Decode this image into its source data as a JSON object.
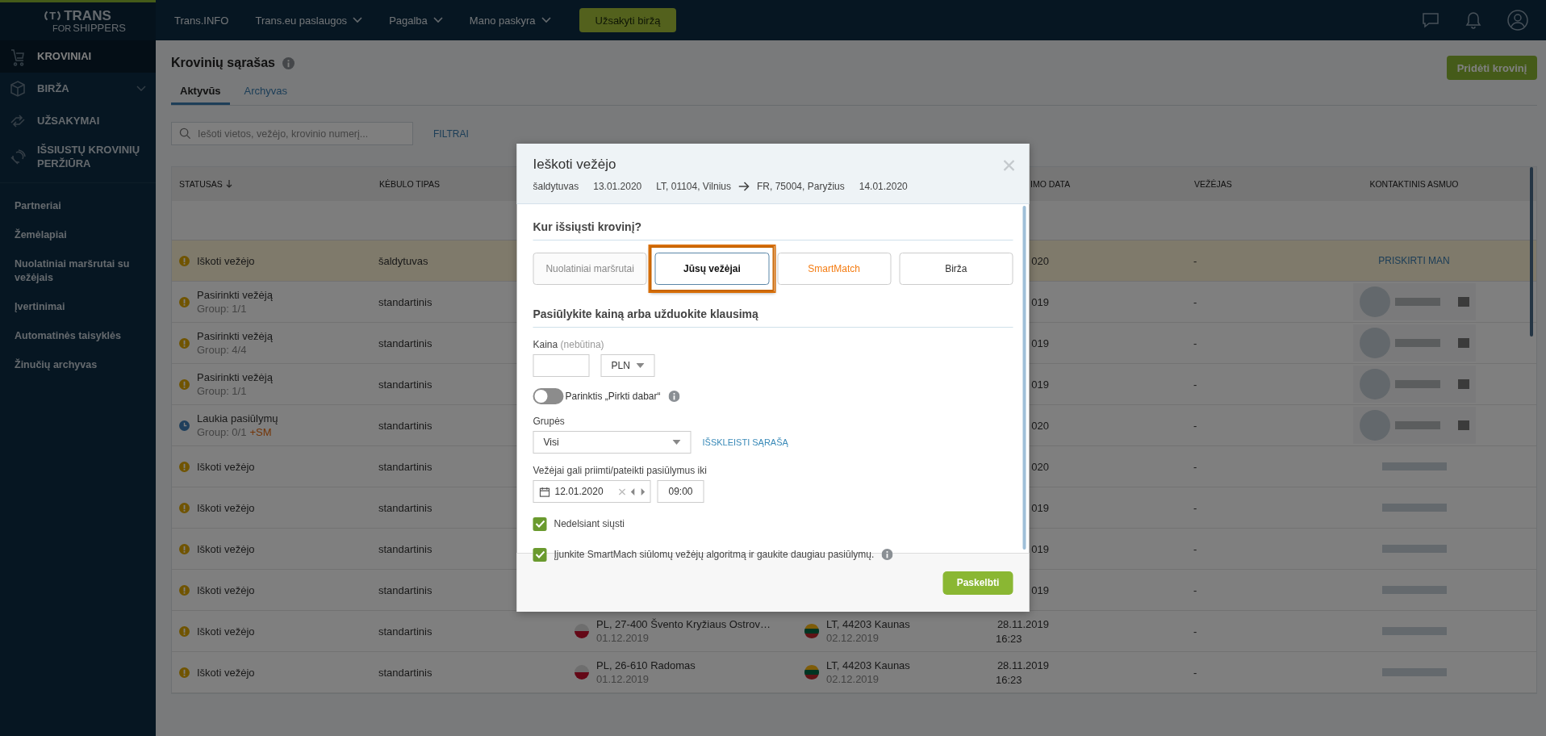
{
  "logo": {
    "mark": "T",
    "name": "TRANS",
    "tagline_small": "FOR",
    "tagline": "SHIPPERS"
  },
  "topnav": {
    "items": [
      {
        "label": "Trans.INFO",
        "dropdown": false
      },
      {
        "label": "Trans.eu paslaugos",
        "dropdown": true
      },
      {
        "label": "Pagalba",
        "dropdown": true
      },
      {
        "label": "Mano paskyra",
        "dropdown": true
      }
    ],
    "cta": "Užsakyti biržą"
  },
  "sidebar": {
    "main": [
      {
        "label": "KROVINIAI",
        "selected": true,
        "expandable": false
      },
      {
        "label": "BIRŽA",
        "selected": false,
        "expandable": true
      },
      {
        "label": "UŽSAKYMAI",
        "selected": false,
        "expandable": false
      },
      {
        "label": "IŠSIUSTŲ KROVINIŲ PERŽIŪRA",
        "selected": false,
        "expandable": false
      }
    ],
    "links": [
      "Partneriai",
      "Žemėlapiai",
      "Nuolatiniai maršrutai su vežėjais",
      "Įvertinimai",
      "Automatinės taisyklės",
      "Žinučių archyvas"
    ]
  },
  "page": {
    "title": "Krovinių sąrašas",
    "add_button": "Pridėti krovinį",
    "tabs": [
      {
        "label": "Aktyvūs",
        "selected": true
      },
      {
        "label": "Archyvas",
        "selected": false
      }
    ],
    "search": {
      "placeholder": "Iešoti vietos, vežėjo, krovinio numerį..."
    },
    "filters": "FILTRAI"
  },
  "table": {
    "columns": {
      "status": "STATUSAS",
      "body": "KĖBULO TIPAS",
      "date": "IMO DATA",
      "carrier": "VEŽĖJAS",
      "contact": "KONTAKTINIS ASMUO"
    },
    "rows": [
      {
        "kind": "warning",
        "status": "Iškoti vežėjo",
        "body": "šaldytuvas",
        "date": "020",
        "carrier": "-",
        "contact": {
          "kind": "assign",
          "text": "PRISKIRTI MAN"
        },
        "highlighted": true
      },
      {
        "kind": "warning",
        "status": "Pasirinkti vežėją",
        "group": "Group: 1/1",
        "body": "standartinis",
        "date": "019",
        "carrier": "-",
        "contact": {
          "kind": "avatar"
        },
        "highlighted": false
      },
      {
        "kind": "warning",
        "status": "Pasirinkti vežėją",
        "group": "Group: 4/4",
        "body": "standartinis",
        "date": "019",
        "carrier": "-",
        "contact": {
          "kind": "avatar"
        },
        "highlighted": false
      },
      {
        "kind": "warning",
        "status": "Pasirinkti vežėją",
        "group": "Group: 1/1",
        "body": "standartinis",
        "date": "019",
        "carrier": "-",
        "contact": {
          "kind": "avatar"
        },
        "highlighted": false
      },
      {
        "kind": "waiting",
        "status": "Laukia pasiūlymų",
        "group": "Group: 0/1",
        "badge": "+SM",
        "body": "standartinis",
        "date": "020",
        "carrier": "-",
        "contact": {
          "kind": "avatar"
        },
        "highlighted": false
      },
      {
        "kind": "warning",
        "status": "Iškoti vežėjo",
        "body": "standartinis",
        "date": "020",
        "carrier": "-",
        "contact": {
          "kind": "blurred"
        },
        "highlighted": false
      },
      {
        "kind": "warning",
        "status": "Iškoti vežėjo",
        "body": "standartinis",
        "date": "019",
        "carrier": "-",
        "contact": {
          "kind": "blurred"
        },
        "highlighted": false
      },
      {
        "kind": "warning",
        "status": "Iškoti vežėjo",
        "body": "standartinis",
        "date": "019",
        "carrier": "-",
        "contact": {
          "kind": "blurred"
        },
        "highlighted": false
      },
      {
        "kind": "warning",
        "status": "Iškoti vežėjo",
        "body": "standartinis",
        "date": "019",
        "carrier": "-",
        "contact": {
          "kind": "blurred"
        },
        "highlighted": false
      },
      {
        "kind": "warning",
        "status": "Iškoti vežėjo",
        "body": "standartinis",
        "loading": {
          "kind": "pl",
          "place": "PL, 27-400 Švento Kryžiaus Ostrov…",
          "date": "01.12.2019"
        },
        "unloading": {
          "kind": "lt",
          "place": "LT, 44203 Kaunas",
          "date": "02.12.2019"
        },
        "date": "28.11.2019",
        "time": "16:23",
        "carrier": "-",
        "contact": {
          "kind": "blurred"
        },
        "highlighted": false
      },
      {
        "kind": "warning",
        "status": "Iškoti vežėjo",
        "body": "standartinis",
        "loading": {
          "kind": "pl",
          "place": "PL, 26-610 Radomas",
          "date": "01.12.2019"
        },
        "unloading": {
          "kind": "lt",
          "place": "LT, 44203 Kaunas",
          "date": "02.12.2019"
        },
        "date": "28.11.2019",
        "time": "16:23",
        "carrier": "-",
        "contact": {
          "kind": "blurred"
        },
        "highlighted": false
      }
    ]
  },
  "modal": {
    "title": "Ieškoti vežėjo",
    "summary": {
      "body": "šaldytuvas",
      "load_date": "13.01.2020",
      "from": "LT, 01104, Vilnius",
      "to": "FR, 75004, Paryžius",
      "unload_date": "14.01.2020"
    },
    "where_heading": "Kur išsiųsti krovinį?",
    "options": [
      {
        "label": "Nuolatiniai maršrutai",
        "kind": "plain",
        "disabled": true,
        "selected": false
      },
      {
        "label": "Jūsų vežėjai",
        "kind": "plain",
        "disabled": false,
        "selected": true
      },
      {
        "label": "SmartMatch",
        "kind": "smartmatch",
        "disabled": false,
        "selected": false
      },
      {
        "label": "Birža",
        "kind": "plain",
        "disabled": false,
        "selected": false
      }
    ],
    "price_heading": "Pasiūlykite kainą arba užduokite klausimą",
    "price": {
      "label": "Kaina",
      "hint": "(nebūtina)",
      "currency": "PLN"
    },
    "buy_now": {
      "label": "Parinktis „Pirkti dabar“",
      "on": false
    },
    "groups": {
      "label": "Grupės",
      "value": "Visi",
      "expand_link": "IŠSKLEISTI SĄRAŠĄ"
    },
    "deadline": {
      "label": "Vežėjai gali priimti/pateikti pasiūlymus iki",
      "date": "12.01.2020",
      "time": "09:00"
    },
    "checks": [
      {
        "label": "Nedelsiant siųsti",
        "checked": true,
        "kind": "plain"
      },
      {
        "label": "Įjunkite SmartMach siūlomų vežėjų algoritmą ir gaukite daugiau pasiūlymų.",
        "checked": true,
        "kind": "with_info"
      }
    ],
    "submit": "Paskelbti"
  }
}
